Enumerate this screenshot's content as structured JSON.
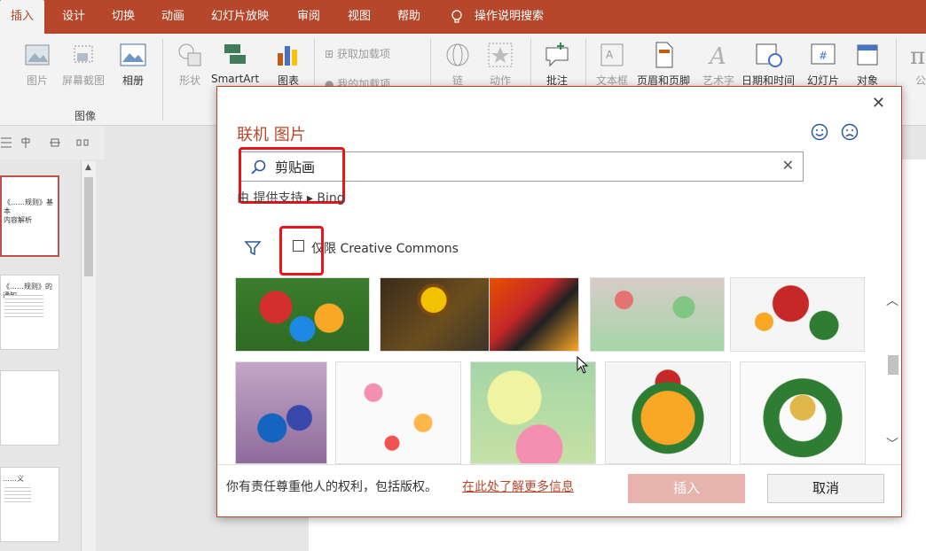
{
  "tabs": [
    "插入",
    "设计",
    "切换",
    "动画",
    "幻灯片放映",
    "审阅",
    "视图",
    "帮助",
    "操作说明搜索"
  ],
  "ribbon": {
    "buttons": {
      "picture": "图片",
      "screenshot": "屏幕截图",
      "album": "相册",
      "shape": "形状",
      "smartart": "SmartArt",
      "chart": "图表",
      "get_addins": "获取加载项",
      "my_addins": "我的加载项",
      "link": "链",
      "action": "动作",
      "comment": "批注",
      "textbox": "文本框",
      "header_footer": "页眉和页脚",
      "wordart": "艺术字",
      "datetime": "日期和时间",
      "slide_number": "幻灯片",
      "object": "对象",
      "formula": "公"
    },
    "group_label": "图像"
  },
  "thumbnails": {
    "slide1": "《……规则》基本\n内容解析",
    "slide2": "《……规则》的通知",
    "slide4": "……义"
  },
  "dialog": {
    "title": "联机 图片",
    "search_value": "剪贴画",
    "powered_by": "由 提供支持",
    "bing": "Bing",
    "cc_label": "仅限 Creative Commons",
    "footer_text": "你有责任尊重他人的权利，包括版权。",
    "footer_link": "在此处了解更多信息",
    "insert_button": "插入",
    "cancel_button": "取消",
    "results_row1": [
      "christmas-ornaments",
      "sunflower-collage",
      "asian-art",
      "scrapbook-flowers",
      "christmas-balls"
    ],
    "results_row2": [
      "parrots-birds",
      "clipart-assortment",
      "lotus-flowers",
      "christmas-ornament-ball",
      "christmas-wreath"
    ]
  },
  "colors": {
    "accent": "#b7472a",
    "highlight_red": "#e8141a",
    "insert_disabled": "#e8b2ad"
  }
}
